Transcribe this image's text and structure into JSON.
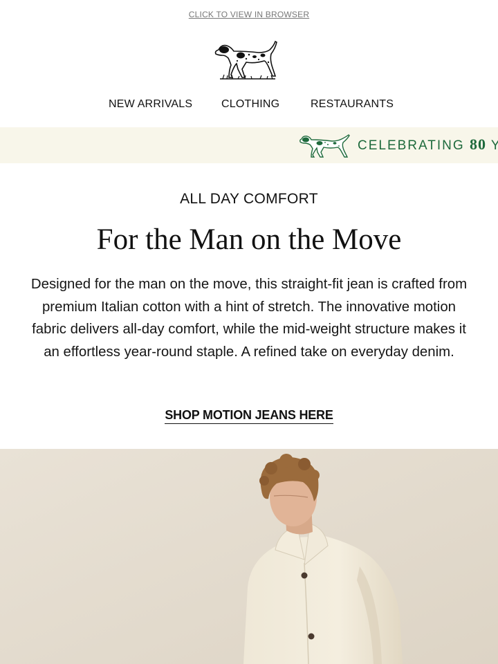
{
  "header": {
    "view_in_browser": "CLICK TO VIEW IN BROWSER"
  },
  "nav": {
    "items": [
      {
        "label": "NEW ARRIVALS"
      },
      {
        "label": "CLOTHING"
      },
      {
        "label": "RESTAURANTS"
      }
    ]
  },
  "banner": {
    "text": "CELEBRATING",
    "number": "80",
    "trailing": "Y",
    "text_color": "#1e6a3c",
    "background": "#f8f6ea"
  },
  "main": {
    "eyebrow": "ALL DAY COMFORT",
    "headline": "For the Man on the Move",
    "body": "Designed for the man on the move, this straight-fit jean is crafted from premium Italian cotton with a hint of stretch. The innovative motion fabric delivers all-day comfort, while the mid-weight structure makes it an effortless year-round staple. A refined take on everyday denim.",
    "cta_label": "SHOP MOTION JEANS HERE"
  },
  "icons": {
    "logo": "pointer-dog-logo-icon",
    "banner_dog": "pointer-dog-icon"
  }
}
